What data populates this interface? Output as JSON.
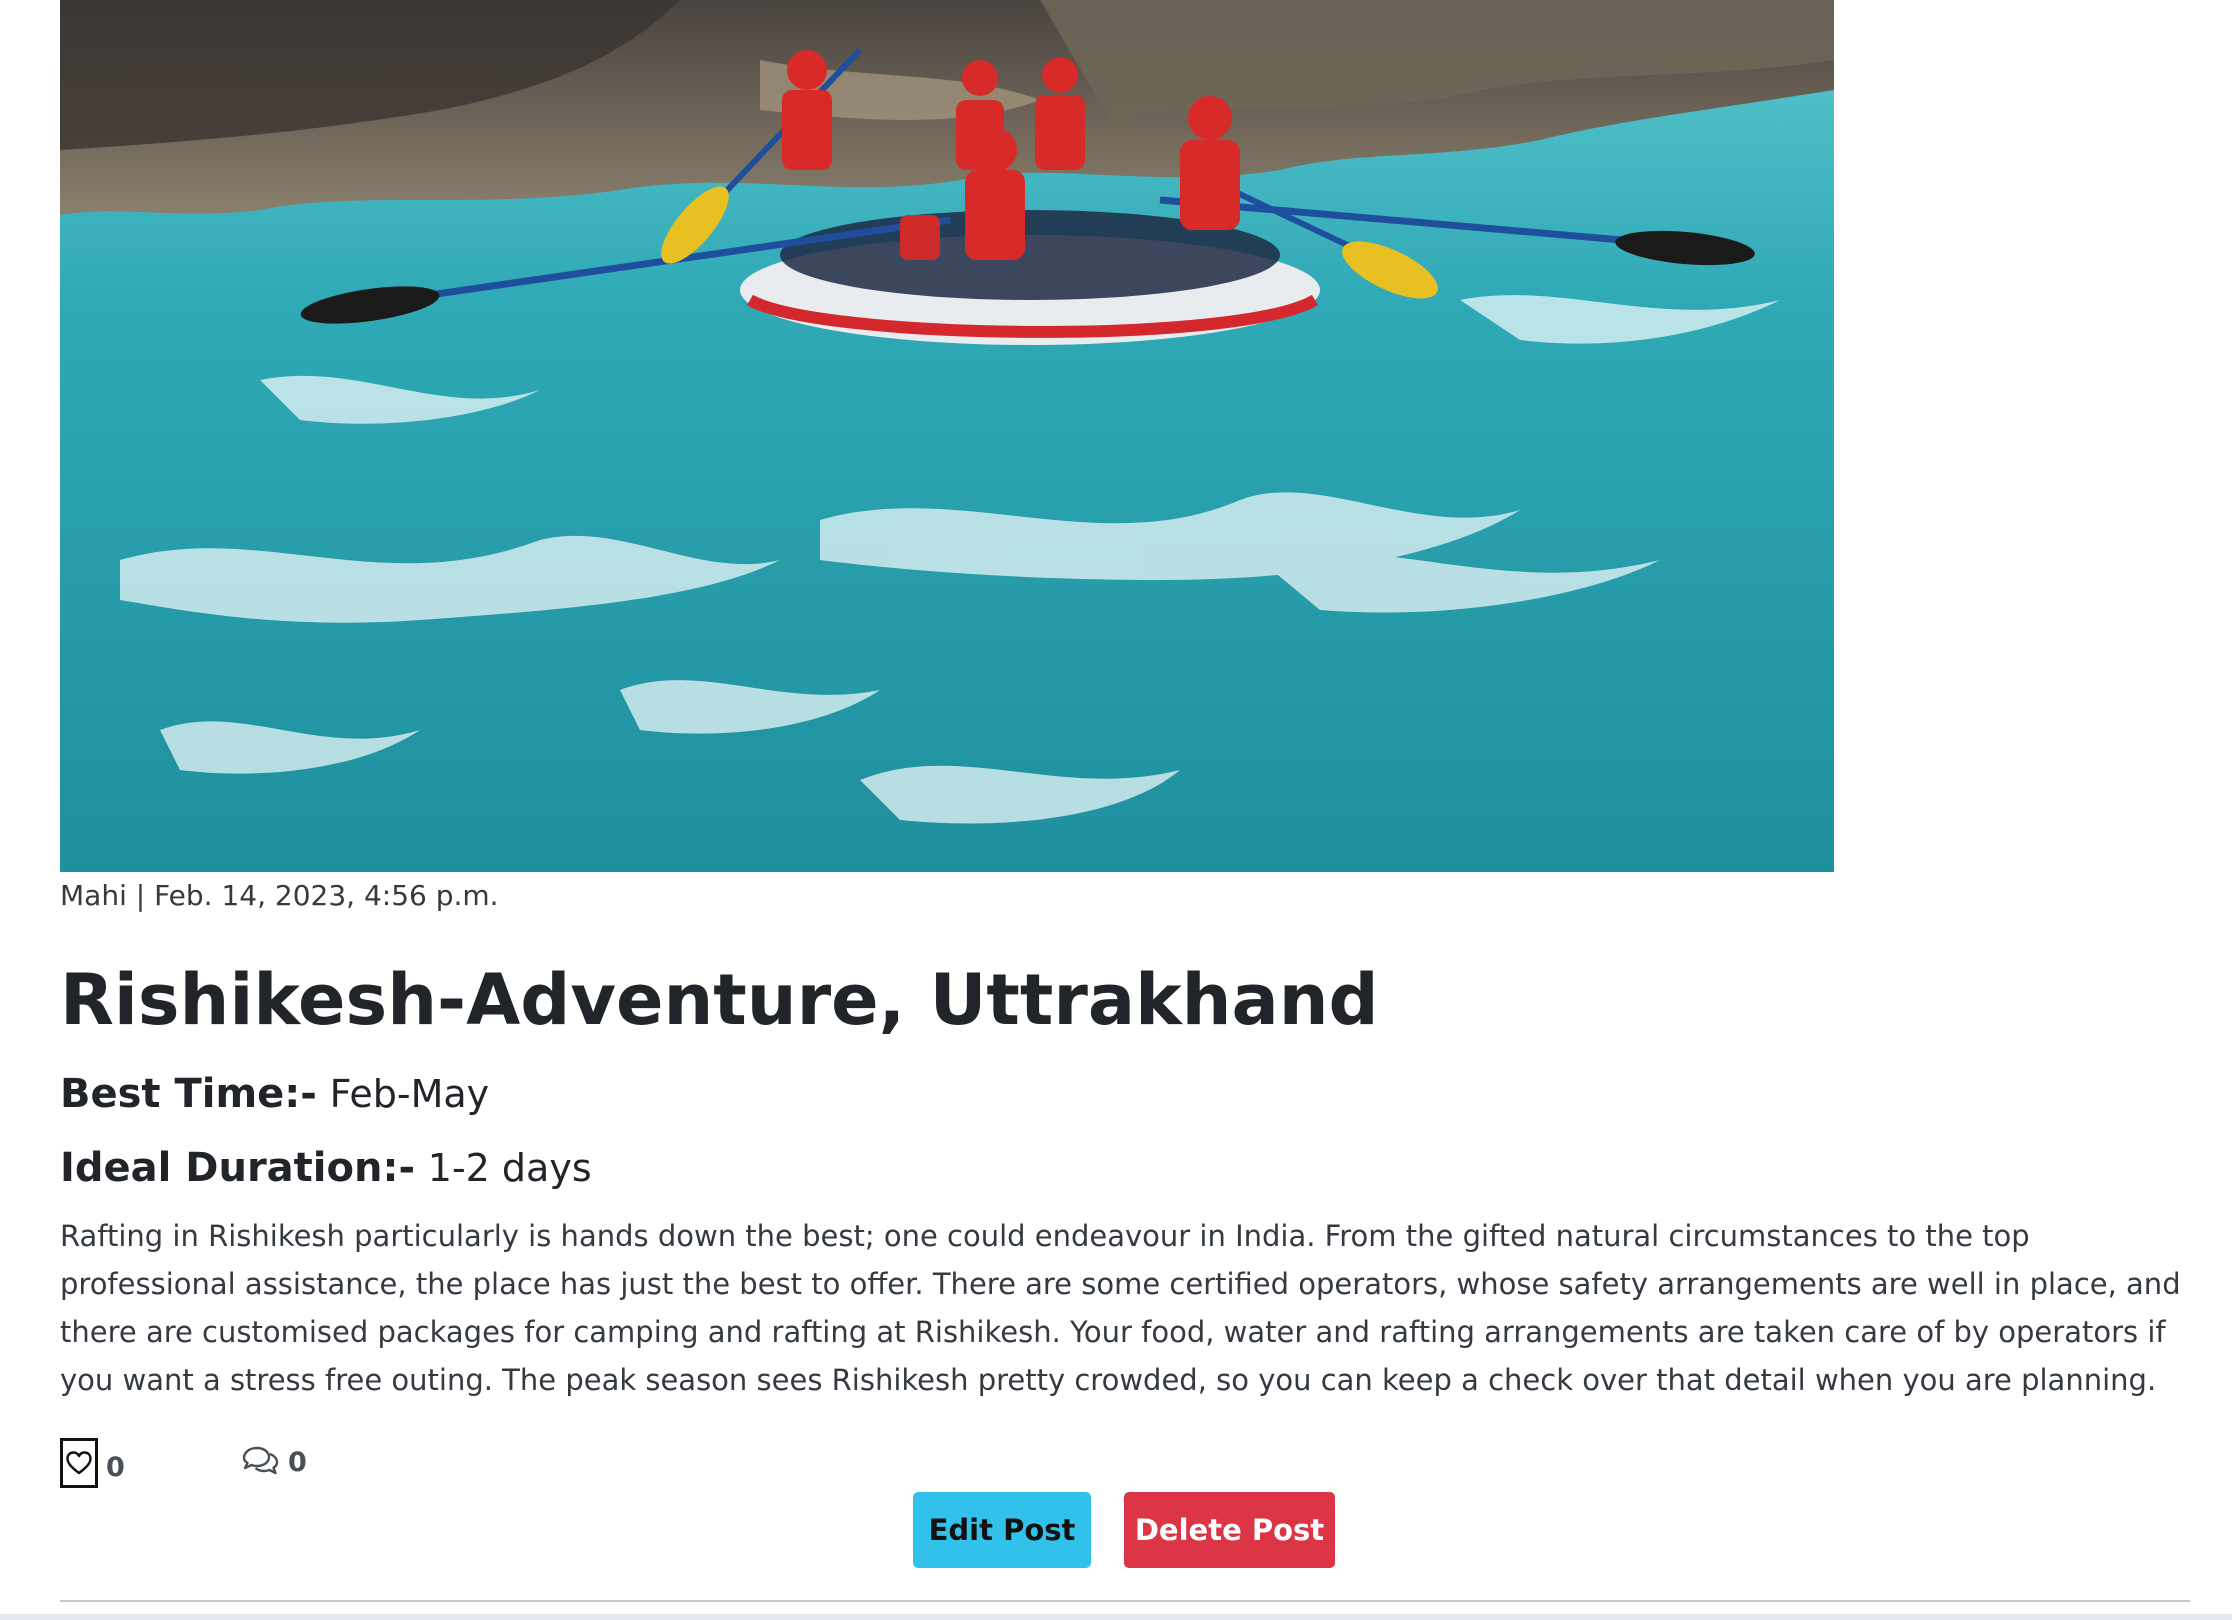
{
  "post": {
    "image_alt": "Rafting on the Ganga river at Rishikesh",
    "meta": "Mahi | Feb. 14, 2023, 4:56 p.m.",
    "title": "Rishikesh-Adventure, Uttrakhand",
    "best_time_label": "Best Time:-",
    "best_time_value": "Feb-May",
    "duration_label": "Ideal Duration:-",
    "duration_value": "1-2 days",
    "description": "Rafting in Rishikesh particularly is hands down the best; one could endeavour in India. From the gifted natural circumstances to the top professional assistance, the place has just the best to offer. There are some certified operators, whose safety arrangements are well in place, and there are customised packages for camping and rafting at Rishikesh. Your food, water and rafting arrangements are taken care of by operators if you want a stress free outing. The peak season sees Rishikesh pretty crowded, so you can keep a check over that detail when you are planning.",
    "likes": "0",
    "comments": "0"
  },
  "actions": {
    "edit_label": "Edit Post",
    "delete_label": "Delete Post"
  },
  "icons": {
    "like": "heart-icon",
    "comment": "comment-bubbles-icon"
  },
  "colors": {
    "edit_button": "#31c1ea",
    "delete_button": "#dc3545",
    "water": "#2aa3ad"
  }
}
